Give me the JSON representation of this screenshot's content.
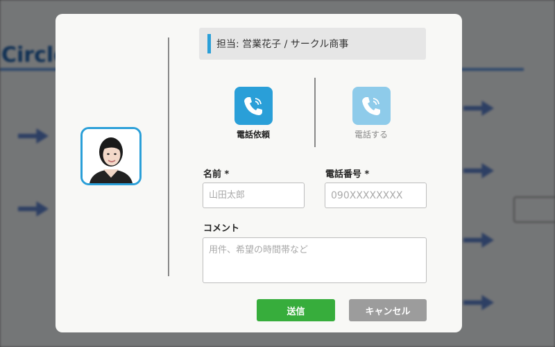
{
  "background": {
    "logo_text": "Circle"
  },
  "modal": {
    "header": "担当: 営業花子 / サークル商事",
    "actions": [
      {
        "label": "電話依頼",
        "icon": "phone-icon",
        "state": "active"
      },
      {
        "label": "電話する",
        "icon": "phone-icon",
        "state": "disabled"
      }
    ],
    "form": {
      "name_label": "名前 *",
      "name_placeholder": "山田太郎",
      "phone_label": "電話番号 *",
      "phone_placeholder": "090XXXXXXXX",
      "comment_label": "コメント",
      "comment_placeholder": "用件、希望の時間帯など"
    },
    "buttons": {
      "send": "送信",
      "cancel": "キャンセル"
    }
  },
  "colors": {
    "accent": "#2a9fd8",
    "send": "#37ad3c",
    "cancel": "#9c9c9c"
  }
}
